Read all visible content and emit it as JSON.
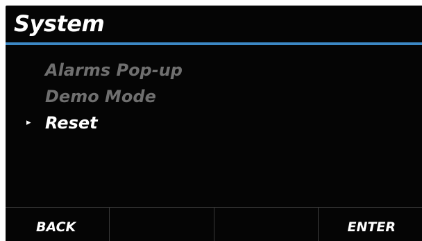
{
  "header": {
    "title": "System",
    "accent_color": "#3c88c5"
  },
  "menu": {
    "selected_index": 2,
    "cursor_glyph": "▸",
    "items": [
      {
        "label": "Alarms Pop-up"
      },
      {
        "label": "Demo Mode"
      },
      {
        "label": "Reset"
      }
    ]
  },
  "softkeys": {
    "keys": [
      {
        "label": "BACK"
      },
      {
        "label": ""
      },
      {
        "label": ""
      },
      {
        "label": "ENTER"
      }
    ]
  }
}
